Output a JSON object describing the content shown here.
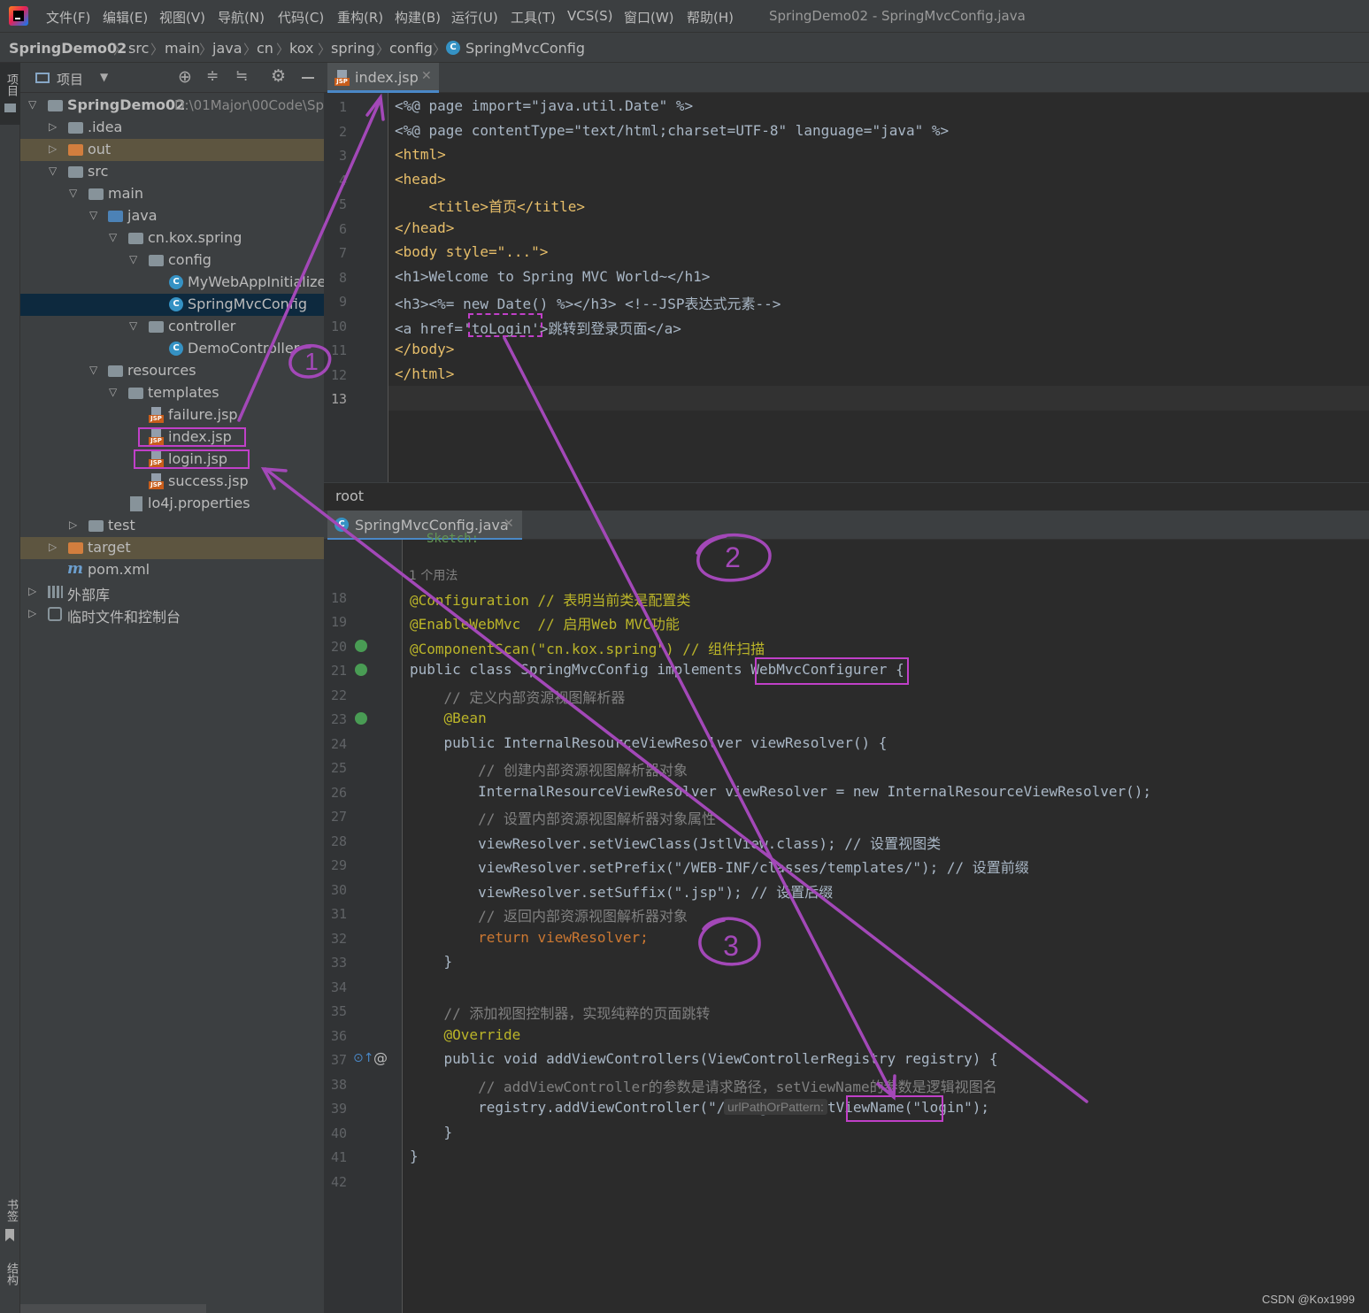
{
  "menubar": {
    "items": [
      "文件(F)",
      "编辑(E)",
      "视图(V)",
      "导航(N)",
      "代码(C)",
      "重构(R)",
      "构建(B)",
      "运行(U)",
      "工具(T)",
      "VCS(S)",
      "窗口(W)",
      "帮助(H)"
    ],
    "window_title": "SpringDemo02 - SpringMvcConfig.java"
  },
  "breadcrumbs": [
    "SpringDemo02",
    "src",
    "main",
    "java",
    "cn",
    "kox",
    "spring",
    "config",
    "SpringMvcConfig"
  ],
  "left_strip": {
    "project": "项目",
    "bookmarks": "书签",
    "structure": "结构"
  },
  "project_panel": {
    "title": "项目",
    "tree": [
      {
        "label": "SpringDemo02",
        "path": "D:\\01Major\\00Code\\Sp",
        "type": "module",
        "bold": true
      },
      {
        "label": ".idea",
        "type": "folder"
      },
      {
        "label": "out",
        "type": "folder-orange"
      },
      {
        "label": "src",
        "type": "folder"
      },
      {
        "label": "main",
        "type": "folder"
      },
      {
        "label": "java",
        "type": "folder-blue"
      },
      {
        "label": "cn.kox.spring",
        "type": "package"
      },
      {
        "label": "config",
        "type": "package"
      },
      {
        "label": "MyWebAppInitializer",
        "type": "class"
      },
      {
        "label": "SpringMvcConfig",
        "type": "class"
      },
      {
        "label": "controller",
        "type": "package"
      },
      {
        "label": "DemoController",
        "type": "class"
      },
      {
        "label": "resources",
        "type": "folder"
      },
      {
        "label": "templates",
        "type": "folder"
      },
      {
        "label": "failure.jsp",
        "type": "jsp"
      },
      {
        "label": "index.jsp",
        "type": "jsp"
      },
      {
        "label": "login.jsp",
        "type": "jsp"
      },
      {
        "label": "success.jsp",
        "type": "jsp"
      },
      {
        "label": "lo4j.properties",
        "type": "props"
      },
      {
        "label": "test",
        "type": "folder"
      },
      {
        "label": "target",
        "type": "folder-orange"
      },
      {
        "label": "pom.xml",
        "type": "maven"
      },
      {
        "label": "外部库",
        "type": "lib"
      },
      {
        "label": "临时文件和控制台",
        "type": "scratch"
      }
    ]
  },
  "editor1": {
    "tab": "index.jsp",
    "line_numbers": [
      "1",
      "2",
      "3",
      "4",
      "5",
      "6",
      "7",
      "8",
      "9",
      "10",
      "11",
      "12",
      "13"
    ],
    "lines": [
      "<%@ page import=\"java.util.Date\" %>",
      "<%@ page contentType=\"text/html;charset=UTF-8\" language=\"java\" %>",
      "<html>",
      "<head>",
      "    <title>首页</title>",
      "</head>",
      "<body style=\"...\">",
      "<h1>Welcome to Spring MVC World~</h1>",
      "<h3><%= new Date() %></h3> <!--JSP表达式元素-->",
      "<a href='toLogin'>跳转到登录页面</a>",
      "</body>",
      "</html>",
      ""
    ]
  },
  "root_label": "root",
  "editor2": {
    "tab": "SpringMvcConfig.java",
    "top_fragment": "Sketch:",
    "usage_hint": "1 个用法",
    "param_hint": "urlPathOrPattern:",
    "line_numbers": [
      "18",
      "19",
      "20",
      "21",
      "22",
      "23",
      "24",
      "25",
      "26",
      "27",
      "28",
      "29",
      "30",
      "31",
      "32",
      "33",
      "34",
      "35",
      "36",
      "37",
      "38",
      "39",
      "40",
      "41",
      "42"
    ],
    "lines": [
      "@Configuration // 表明当前类是配置类",
      "@EnableWebMvc  // 启用Web MVC功能",
      "@ComponentScan(\"cn.kox.spring\") // 组件扫描",
      "public class SpringMvcConfig implements WebMvcConfigurer {",
      "    // 定义内部资源视图解析器",
      "    @Bean",
      "    public InternalResourceViewResolver viewResolver() {",
      "        // 创建内部资源视图解析器对象",
      "        InternalResourceViewResolver viewResolver = new InternalResourceViewResolver();",
      "        // 设置内部资源视图解析器对象属性",
      "        viewResolver.setViewClass(JstlView.class); // 设置视图类",
      "        viewResolver.setPrefix(\"/WEB-INF/classes/templates/\"); // 设置前缀",
      "        viewResolver.setSuffix(\".jsp\"); // 设置后缀",
      "        // 返回内部资源视图解析器对象",
      "        return viewResolver;",
      "    }",
      "",
      "    // 添加视图控制器，实现纯粹的页面跳转",
      "    @Override",
      "    public void addViewControllers(ViewControllerRegistry registry) {",
      "        // addViewController的参数是请求路径，setViewName的参数是逻辑视图名",
      "        registry.addViewController(\"/toLogin\").setViewName(\"login\");",
      "    }",
      "}",
      ""
    ]
  },
  "annotations": {
    "circle1": "1",
    "circle2": "2",
    "circle3": "3",
    "color": "#c040c8"
  },
  "watermark": "CSDN @Kox1999"
}
